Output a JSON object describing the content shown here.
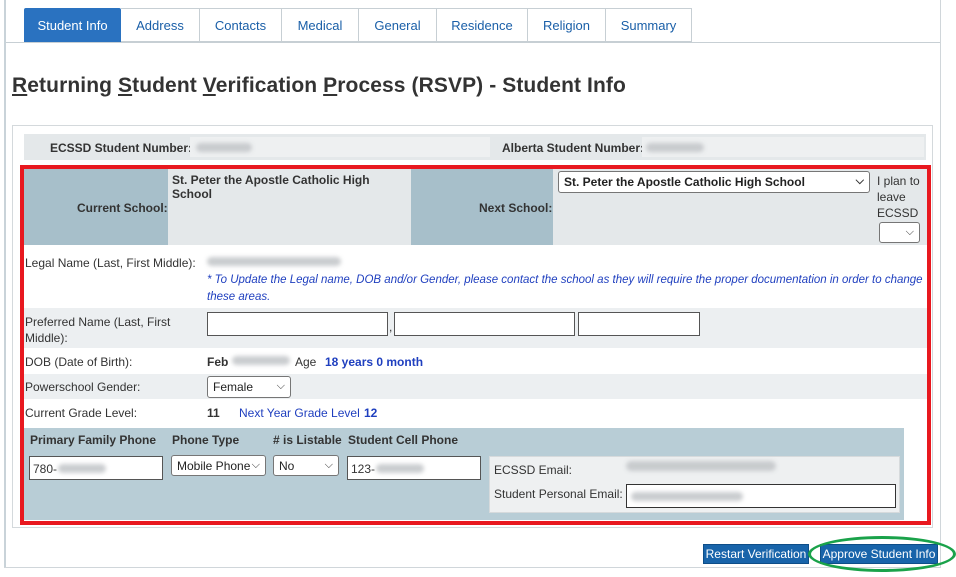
{
  "tabs": [
    {
      "label": "Student Info",
      "active": true
    },
    {
      "label": "Address"
    },
    {
      "label": "Contacts"
    },
    {
      "label": "Medical"
    },
    {
      "label": "General"
    },
    {
      "label": "Residence"
    },
    {
      "label": "Religion"
    },
    {
      "label": "Summary"
    }
  ],
  "page_title": {
    "p1": "R",
    "p2": "eturning ",
    "p3": "S",
    "p4": "tudent ",
    "p5": "V",
    "p6": "erification ",
    "p7": "P",
    "p8": "rocess (RSVP) - Student Info"
  },
  "student_numbers": {
    "ecssd_label": "ECSSD Student Number:",
    "alberta_label": "Alberta Student Number:"
  },
  "school": {
    "current_label": "Current School:",
    "current_value": "St. Peter the Apostle Catholic High School",
    "next_label": "Next School:",
    "next_value": "St. Peter the Apostle Catholic High School",
    "leave_text": "I plan to leave ECSSD"
  },
  "legal_name": {
    "label": "Legal Name (Last, First Middle):",
    "note": "* To Update the Legal name, DOB and/or Gender, please contact the school as they will require the proper documentation in order to change these areas."
  },
  "preferred_name": {
    "label": "Preferred Name (Last, First Middle):",
    "separator": ","
  },
  "dob": {
    "label": "DOB (Date of Birth):",
    "month": "Feb",
    "age_label": "Age",
    "age_value": "18 years 0 month"
  },
  "gender": {
    "label": "Powerschool Gender:",
    "value": "Female"
  },
  "grade": {
    "label": "Current Grade Level:",
    "current": "11",
    "next_label": "Next Year Grade Level",
    "next": "12"
  },
  "phones": {
    "family_label": "Primary Family Phone",
    "type_label": "Phone Type",
    "listable_label": "# is Listable",
    "cell_label": "Student Cell Phone",
    "family_prefix": "780-",
    "type_value": "Mobile Phone",
    "listable_value": "No",
    "cell_prefix": "123-"
  },
  "email": {
    "ecssd_label": "ECSSD Email:",
    "personal_label": "Student Personal Email:"
  },
  "buttons": {
    "restart": "Restart Verification",
    "approve": "Approve Student Info"
  },
  "colors": {
    "accent": "#1864aa",
    "highlight_red": "#e8181f",
    "highlight_green": "#1aa24a",
    "label_cell": "#a7bfca"
  }
}
